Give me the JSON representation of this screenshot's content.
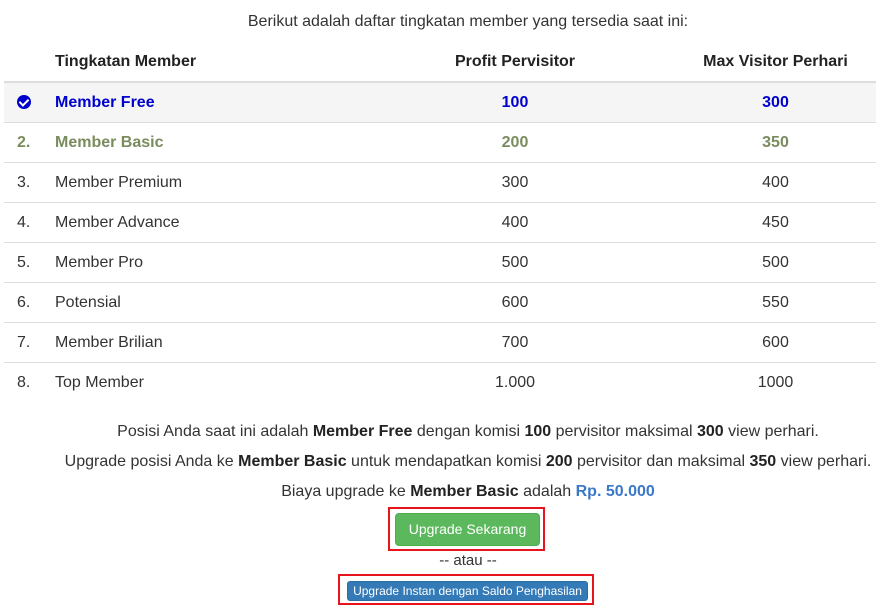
{
  "intro": "Berikut adalah daftar tingkatan member yang tersedia saat ini:",
  "table": {
    "headers": {
      "level": "Tingkatan Member",
      "profit": "Profit Pervisitor",
      "max": "Max Visitor Perhari"
    },
    "rows": [
      {
        "no": "",
        "name": "Member Free",
        "profit": "100",
        "max": "300",
        "status": "current"
      },
      {
        "no": "2.",
        "name": "Member Basic",
        "profit": "200",
        "max": "350",
        "status": "next"
      },
      {
        "no": "3.",
        "name": "Member Premium",
        "profit": "300",
        "max": "400"
      },
      {
        "no": "4.",
        "name": "Member Advance",
        "profit": "400",
        "max": "450"
      },
      {
        "no": "5.",
        "name": "Member Pro",
        "profit": "500",
        "max": "500"
      },
      {
        "no": "6.",
        "name": "Potensial",
        "profit": "600",
        "max": "550"
      },
      {
        "no": "7.",
        "name": "Member Brilian",
        "profit": "700",
        "max": "600"
      },
      {
        "no": "8.",
        "name": "Top Member",
        "profit": "1.000",
        "max": "1000"
      }
    ]
  },
  "info1": {
    "t1": "Posisi Anda saat ini adalah ",
    "level": "Member Free",
    "t2": " dengan komisi ",
    "profit": "100",
    "t3": " pervisitor maksimal ",
    "max": "300",
    "t4": " view perhari."
  },
  "info2": {
    "t1": "Upgrade posisi Anda ke ",
    "level": "Member Basic",
    "t2": " untuk mendapatkan komisi ",
    "profit": "200",
    "t3": " pervisitor dan maksimal ",
    "max": "350",
    "t4": " view perhari."
  },
  "info3": {
    "t1": "Biaya upgrade ke ",
    "level": "Member Basic",
    "t2": " adalah ",
    "price": "Rp. 50.000"
  },
  "buttons": {
    "upgrade": "Upgrade Sekarang",
    "or": "-- atau --",
    "instant": "Upgrade Instan dengan Saldo Penghasilan"
  },
  "colors": {
    "current_row": "#0000cc",
    "next_row": "#7a8c5e",
    "upgrade_button": "#5cb85c",
    "instant_button": "#337ab7",
    "highlight": "#e8141c",
    "price": "#3a78c8"
  }
}
